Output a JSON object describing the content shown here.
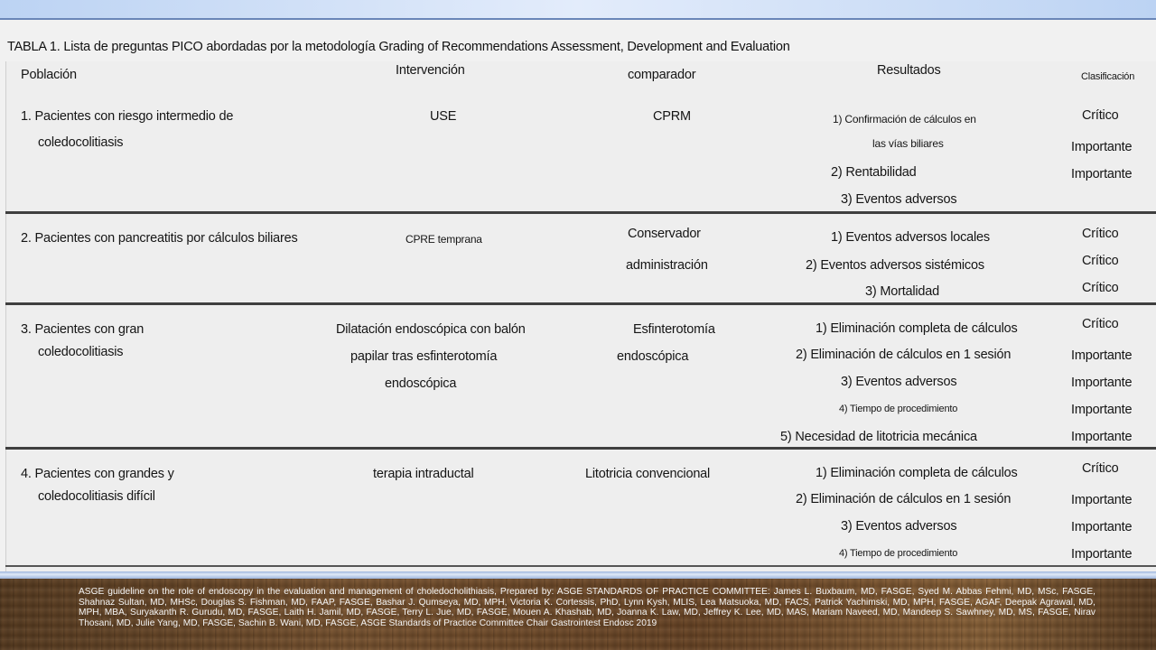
{
  "title": "TABLA 1. Lista de preguntas PICO abordadas por la metodología Grading of Recommendations Assessment, Development and Evaluation",
  "headers": {
    "poblacion": "Población",
    "intervencion": "Intervención",
    "comparador": "comparador",
    "resultados": "Resultados",
    "clasificacion": "Clasificación"
  },
  "rows": [
    {
      "pob": [
        "1. Pacientes con riesgo intermedio de",
        "coledocolitiasis"
      ],
      "int": [
        "USE"
      ],
      "comp": [
        "CPRM"
      ],
      "res": [
        "1) Confirmación de cálculos en",
        "las vías biliares",
        "2) Rentabilidad",
        "3) Eventos adversos"
      ],
      "clas": [
        "Crítico",
        "Importante",
        "Importante"
      ]
    },
    {
      "pob": [
        "2. Pacientes con pancreatitis por cálculos biliares"
      ],
      "int": [
        "CPRE temprana"
      ],
      "comp": [
        "Conservador",
        "administración"
      ],
      "res": [
        "1) Eventos adversos locales",
        "2) Eventos adversos sistémicos",
        "3) Mortalidad"
      ],
      "clas": [
        "Crítico",
        "Crítico",
        "Crítico"
      ]
    },
    {
      "pob": [
        "3. Pacientes con gran",
        "coledocolitiasis"
      ],
      "int": [
        "Dilatación endoscópica con balón",
        "papilar tras esfinterotomía",
        "endoscópica"
      ],
      "comp": [
        "Esfinterotomía",
        "endoscópica"
      ],
      "res": [
        "1) Eliminación completa de cálculos",
        "2) Eliminación de cálculos en 1 sesión",
        "3) Eventos adversos",
        "4) Tiempo de procedimiento",
        "5) Necesidad de litotricia mecánica"
      ],
      "clas": [
        "Crítico",
        "Importante",
        "Importante",
        "Importante",
        "Importante"
      ]
    },
    {
      "pob": [
        "4. Pacientes con grandes y",
        "coledocolitiasis difícil"
      ],
      "int": [
        "terapia intraductal"
      ],
      "comp": [
        "Litotricia convencional"
      ],
      "res": [
        "1) Eliminación completa de cálculos",
        "2) Eliminación de cálculos en 1 sesión",
        "3) Eventos adversos",
        "4) Tiempo de procedimiento"
      ],
      "clas": [
        "Crítico",
        "Importante",
        "Importante",
        "Importante"
      ]
    }
  ],
  "reference": "ASGE guideline on the role of endoscopy in the evaluation and management of choledocholithiasis, Prepared by: ASGE STANDARDS OF PRACTICE COMMITTEE: James L. Buxbaum, MD, FASGE, Syed M. Abbas Fehmi, MD, MSc, FASGE, Shahnaz Sultan, MD, MHSc, Douglas S. Fishman, MD, FAAP, FASGE, Bashar J. Qumseya, MD, MPH, Victoria K. Cortessis, PhD, Lynn Kysh, MLIS, Lea Matsuoka, MD, FACS, Patrick Yachimski, MD, MPH, FASGE, AGAF, Deepak Agrawal, MD, MPH, MBA, Suryakanth R. Gurudu, MD, FASGE, Laith H. Jamil, MD, FASGE, Terry L. Jue, MD, FASGE, Mouen A. Khashab, MD, Joanna K. Law, MD, Jeffrey K. Lee, MD, MAS, Mariam Naveed, MD, Mandeep S. Sawhney, MD, MS, FASGE, Nirav Thosani, MD, Julie Yang, MD, FASGE, Sachin B. Wani, MD, FASGE, ASGE Standards of Practice Committee Chair Gastrointest Endosc 2019"
}
